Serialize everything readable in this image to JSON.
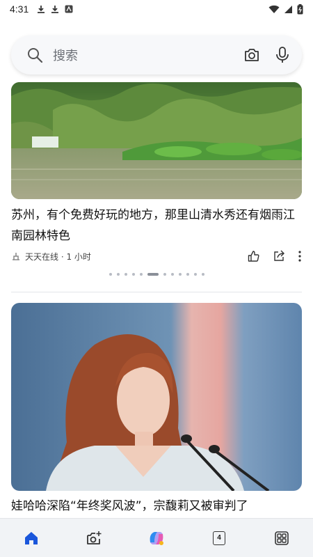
{
  "status_bar": {
    "time": "4:31",
    "left_icons": [
      "download-icon",
      "download-icon",
      "app-icon"
    ],
    "right_icons": [
      "wifi-icon",
      "signal-icon",
      "battery-icon"
    ]
  },
  "search": {
    "placeholder": "搜索",
    "icons": [
      "search-icon",
      "camera-icon",
      "mic-icon"
    ]
  },
  "feed": [
    {
      "image": "landscape-waterfall-pond",
      "title": "苏州，有个免费好玩的地方，那里山清水秀还有烟雨江南园林特色",
      "source": "天天在线 · 1 小时",
      "actions": [
        "like-icon",
        "share-icon",
        "more-icon"
      ]
    },
    {
      "image": "woman-speaking-at-podium",
      "title": "娃哈哈深陷“年终奖风波”，宗馥莉又被审判了"
    }
  ],
  "carousel": {
    "count": 12,
    "active_index": 5
  },
  "bottom_nav": {
    "items": [
      "home-icon",
      "camera-sparkle-icon",
      "copilot-icon",
      "tabs-icon",
      "apps-icon"
    ],
    "tab_count": "4"
  },
  "colors": {
    "accent": "#1a56db",
    "background": "#ffffff",
    "nav_bg": "#f1f3f6"
  }
}
